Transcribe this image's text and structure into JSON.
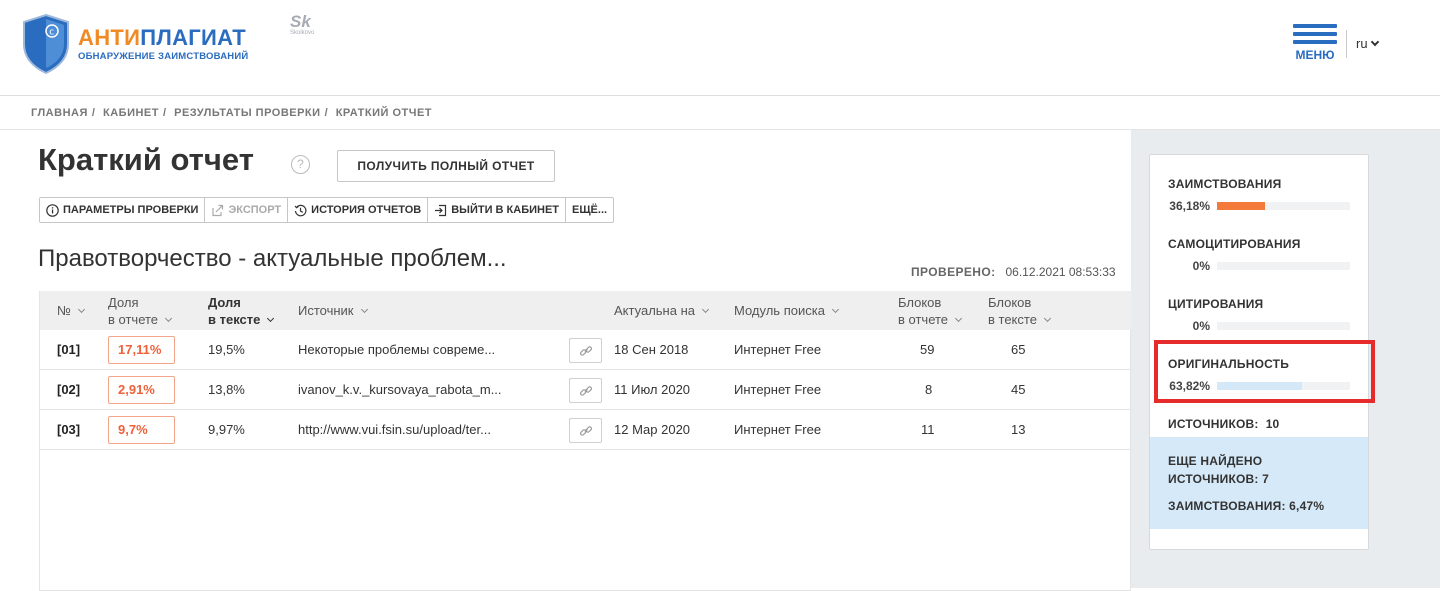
{
  "header": {
    "logo": {
      "word_orange": "АНТИ",
      "word_blue": "ПЛАГИАТ",
      "subtitle": "ОБНАРУЖЕНИЕ ЗАИМСТВОВАНИЙ"
    },
    "partner_logo": {
      "mark": "Sk",
      "name": "Skolkovo"
    },
    "menu_label": "МЕНЮ",
    "language": "ru"
  },
  "breadcrumb": [
    "ГЛАВНАЯ",
    "КАБИНЕТ",
    "РЕЗУЛЬТАТЫ ПРОВЕРКИ",
    "КРАТКИЙ ОТЧЕТ"
  ],
  "page": {
    "title": "Краткий отчет",
    "help": "?",
    "full_report_button": "ПОЛУЧИТЬ ПОЛНЫЙ ОТЧЕТ"
  },
  "toolbar": {
    "params": "ПАРАМЕТРЫ ПРОВЕРКИ",
    "export": "ЭКСПОРТ",
    "history": "ИСТОРИЯ ОТЧЕТОВ",
    "exit": "ВЫЙТИ В КАБИНЕТ",
    "more": "ЕЩЁ..."
  },
  "document": {
    "title": "Правотворчество - актуальные проблем...",
    "checked_label": "ПРОВЕРЕНО:",
    "checked_date": "06.12.2021 08:53:33"
  },
  "table": {
    "headers": {
      "num": "№",
      "share_report_1": "Доля",
      "share_report_2": "в отчете",
      "share_text_1": "Доля",
      "share_text_2": "в тексте",
      "source": "Источник",
      "actual": "Актуальна на",
      "module": "Модуль поиска",
      "blocks_report_1": "Блоков",
      "blocks_report_2": "в отчете",
      "blocks_text_1": "Блоков",
      "blocks_text_2": "в тексте"
    },
    "rows": [
      {
        "num": "[01]",
        "share_report": "17,11%",
        "share_text": "19,5%",
        "source": "Некоторые проблемы совреме...",
        "date": "18 Сен 2018",
        "module": "Интернет Free",
        "blocks_report": "59",
        "blocks_text": "65"
      },
      {
        "num": "[02]",
        "share_report": "2,91%",
        "share_text": "13,8%",
        "source": "ivanov_k.v._kursovaya_rabota_m...",
        "date": "11 Июл 2020",
        "module": "Интернет Free",
        "blocks_report": "8",
        "blocks_text": "45"
      },
      {
        "num": "[03]",
        "share_report": "9,7%",
        "share_text": "9,97%",
        "source": "http://www.vui.fsin.su/upload/ter...",
        "date": "12 Мар 2020",
        "module": "Интернет Free",
        "blocks_report": "11",
        "blocks_text": "13"
      }
    ]
  },
  "stats": {
    "borrowings": {
      "label": "ЗАИМСТВОВАНИЯ",
      "value": "36,18%",
      "fraction": 0.3618,
      "color": "#f47a3c"
    },
    "self_citations": {
      "label": "САМОЦИТИРОВАНИЯ",
      "value": "0%",
      "fraction": 0,
      "color": "#f47a3c"
    },
    "citations": {
      "label": "ЦИТИРОВАНИЯ",
      "value": "0%",
      "fraction": 0,
      "color": "#f47a3c"
    },
    "originality": {
      "label": "ОРИГИНАЛЬНОСТЬ",
      "value": "63,82%",
      "fraction": 0.6382,
      "color": "#d4e8f8"
    },
    "sources_label": "ИСТОЧНИКОВ:",
    "sources_count": "10",
    "more_found_line1": "ЕЩЕ НАЙДЕНО",
    "more_found_line2": "ИСТОЧНИКОВ: 7",
    "more_borrowings": "ЗАИМСТВОВАНИЯ: 6,47%"
  },
  "colors": {
    "brand_blue": "#2a6cbf",
    "brand_orange": "#f08a24",
    "highlight_red": "#e52b2b"
  }
}
